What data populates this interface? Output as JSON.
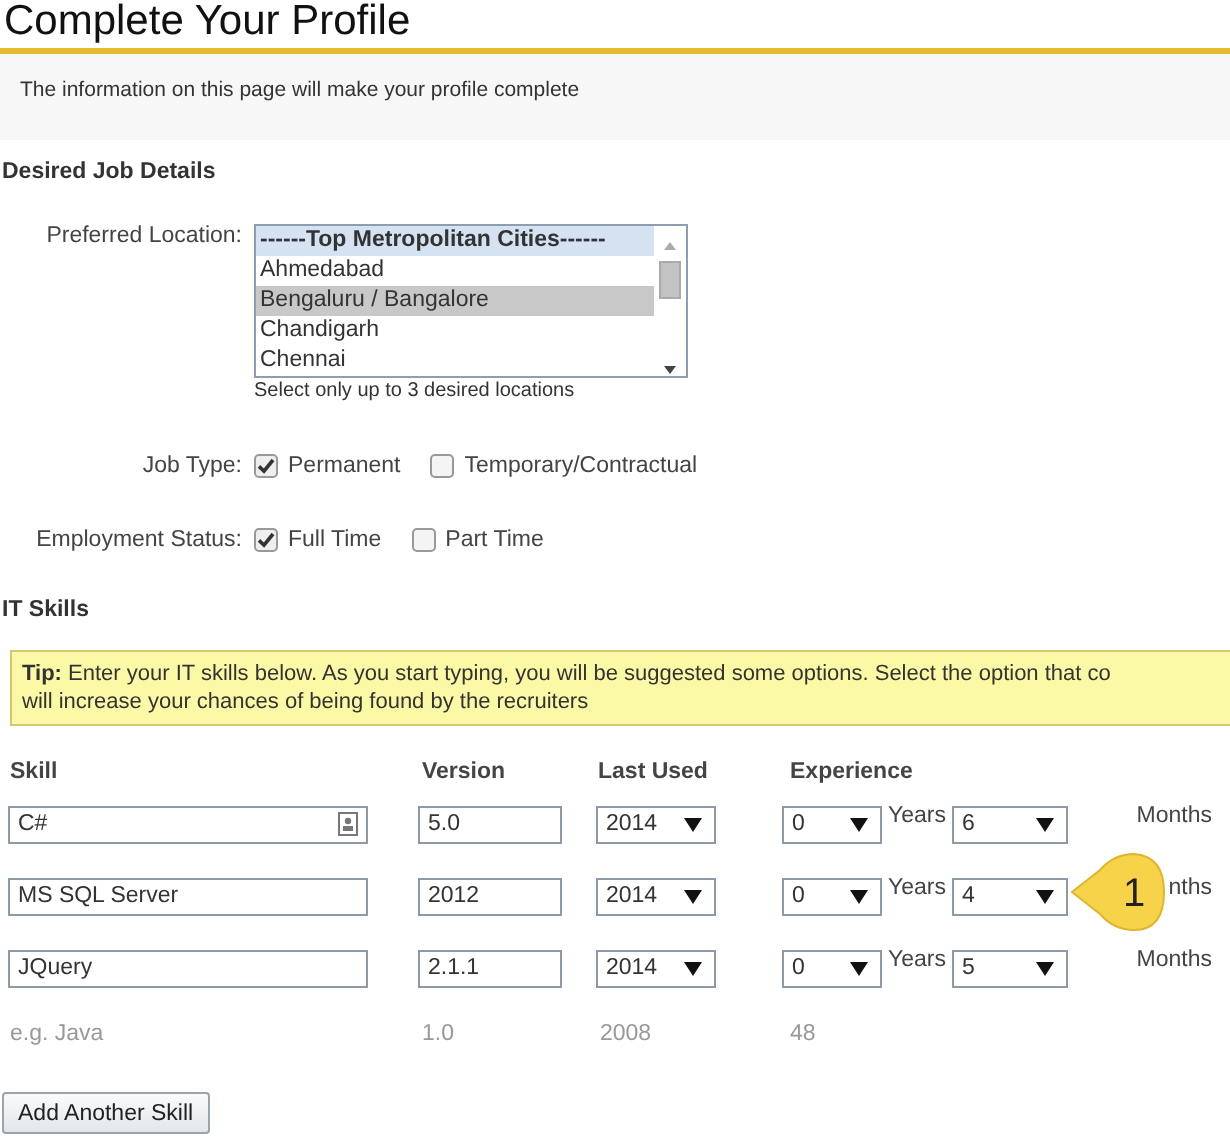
{
  "title": "Complete Your Profile",
  "intro": "The information on this page will make your profile complete",
  "job_details": {
    "heading": "Desired Job Details",
    "location": {
      "label": "Preferred Location:",
      "hint": "Select only up to 3 desired locations",
      "options": [
        {
          "label": "------Top Metropolitan Cities------",
          "kind": "group",
          "selected": false
        },
        {
          "label": "Ahmedabad",
          "kind": "option",
          "selected": false
        },
        {
          "label": "Bengaluru / Bangalore",
          "kind": "option",
          "selected": true
        },
        {
          "label": "Chandigarh",
          "kind": "option",
          "selected": false
        },
        {
          "label": "Chennai",
          "kind": "option",
          "selected": false
        }
      ]
    },
    "job_type": {
      "label": "Job Type:",
      "choices": [
        {
          "label": "Permanent",
          "checked": true
        },
        {
          "label": "Temporary/Contractual",
          "checked": false
        }
      ]
    },
    "employment_status": {
      "label": "Employment Status:",
      "choices": [
        {
          "label": "Full Time",
          "checked": true
        },
        {
          "label": "Part Time",
          "checked": false
        }
      ]
    }
  },
  "it_skills": {
    "heading": "IT Skills",
    "tip": {
      "lead": "Tip:",
      "lines": [
        "Enter your IT skills below. As you start typing, you will be suggested some options. Select the option that co",
        "will increase your chances of being found by the recruiters"
      ]
    },
    "columns": [
      "Skill",
      "Version",
      "Last Used",
      "Experience"
    ],
    "rows": [
      {
        "skill": "C#",
        "contact_icon": true,
        "version": "5.0",
        "last_used": "2014",
        "years": "0",
        "years_label": "Years",
        "months": "6",
        "months_label": "Months"
      },
      {
        "skill": "MS SQL Server",
        "contact_icon": false,
        "version": "2012",
        "last_used": "2014",
        "years": "0",
        "years_label": "Years",
        "months": "4",
        "months_label": "nths"
      },
      {
        "skill": "JQuery",
        "contact_icon": false,
        "version": "2.1.1",
        "last_used": "2014",
        "years": "0",
        "years_label": "Years",
        "months": "5",
        "months_label": "Months"
      }
    ],
    "example": {
      "skill": "e.g. Java",
      "version": "1.0",
      "last_used": "2008",
      "experience": "48"
    },
    "add_button": "Add Another Skill"
  },
  "callout": {
    "number": "1"
  }
}
